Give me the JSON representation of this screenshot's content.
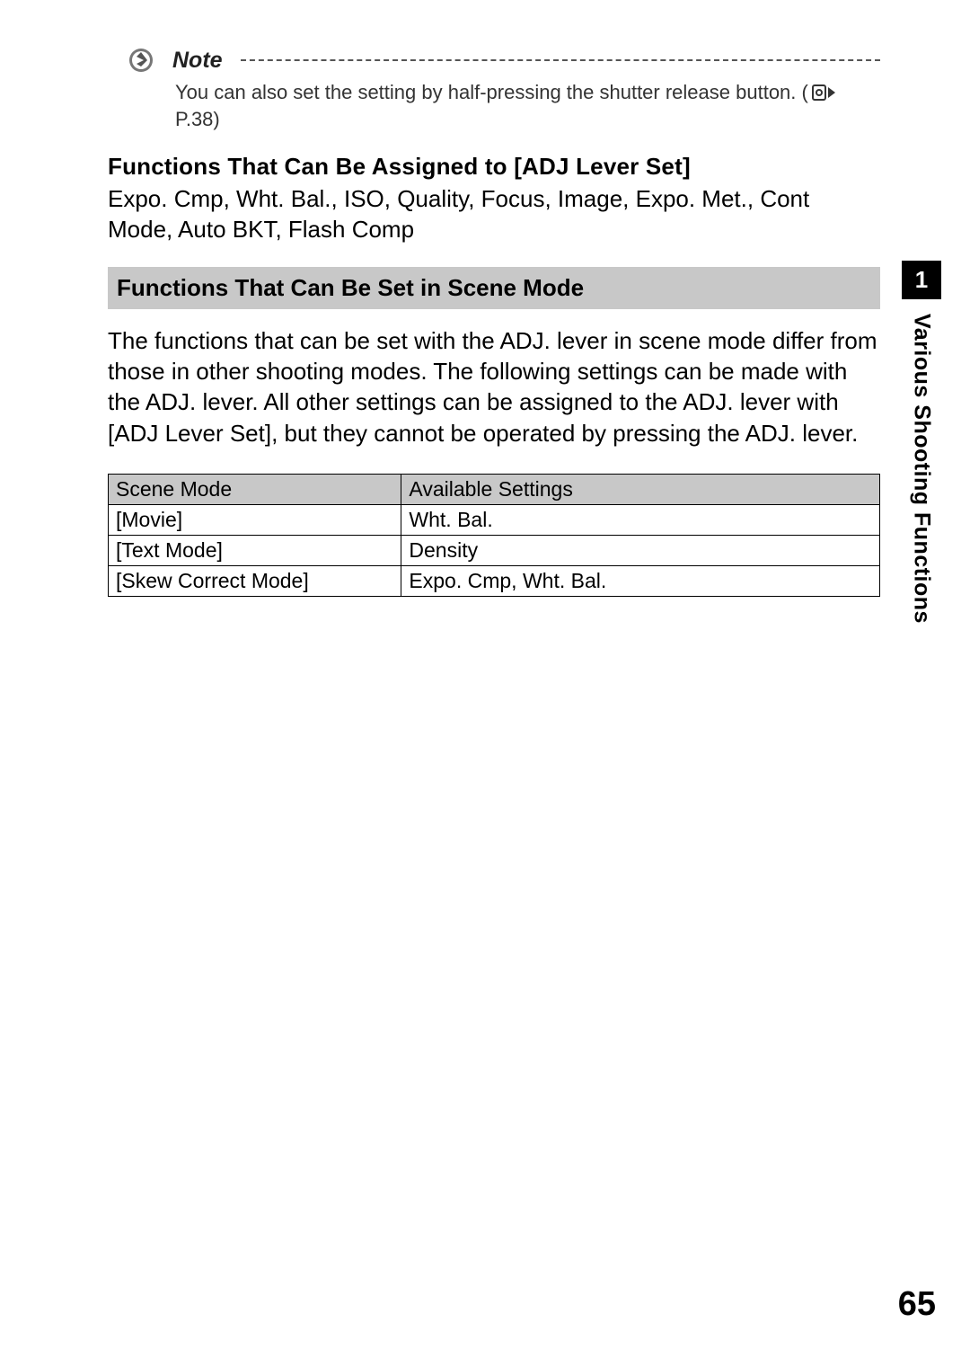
{
  "note": {
    "label": "Note",
    "text": "You can also set the setting by half-pressing the shutter release button. (",
    "ref": "P.38)",
    "ref_icon_name": "page-reference-icon"
  },
  "assign": {
    "heading": "Functions That Can Be Assigned to [ADJ Lever Set]",
    "body": "Expo. Cmp, Wht. Bal., ISO, Quality, Focus, Image, Expo. Met., Cont Mode, Auto BKT, Flash Comp"
  },
  "section": {
    "heading": "Functions That Can Be Set in Scene Mode",
    "body": "The functions that can be set with the ADJ. lever in scene mode differ from those in other shooting modes. The following settings can be made with the ADJ. lever. All other settings can be assigned to the ADJ. lever with [ADJ Lever Set], but they cannot be operated by pressing the ADJ. lever."
  },
  "table": {
    "headers": {
      "mode": "Scene Mode",
      "settings": "Available Settings"
    },
    "rows": [
      {
        "mode": "[Movie]",
        "settings": "Wht. Bal."
      },
      {
        "mode": "[Text Mode]",
        "settings": "Density"
      },
      {
        "mode": "[Skew Correct Mode]",
        "settings": "Expo. Cmp, Wht. Bal."
      }
    ]
  },
  "side_tab": {
    "number": "1",
    "label": "Various Shooting Functions"
  },
  "page_number": "65"
}
